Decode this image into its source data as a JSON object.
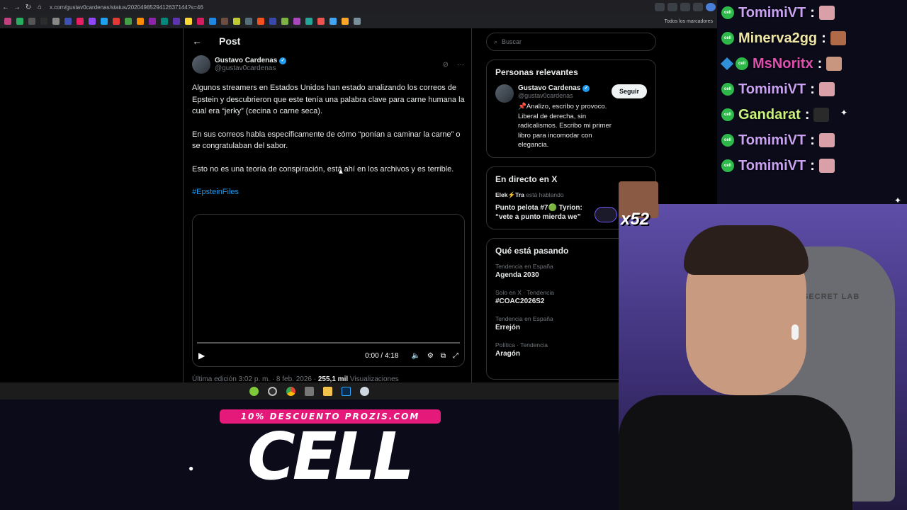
{
  "browser": {
    "url": "x.com/gustav0cardenas/status/2020498529412637144?s=46",
    "bookmarks_folder": "Todos los marcadores"
  },
  "post": {
    "header_title": "Post",
    "author_name": "Gustavo Cardenas",
    "author_handle": "@gustav0cardenas",
    "paragraphs": [
      "Algunos streamers en Estados Unidos han estado analizando los correos de Epstein y descubrieron que este tenía una palabra clave para carne humana la cual era “jerky” (cecina o carne seca).",
      "En sus correos habla específicamente de cómo “ponían a caminar la carne” o se congratulaban del sabor.",
      "Esto no es una teoría de conspiración, está ahí en los archivos y es terrible."
    ],
    "hashtag": "#EpsteinFiles",
    "video_time": "0:00 / 4:18",
    "edit_line_prefix": "Última edición 3:02 p. m. · 8 feb. 2026 · ",
    "views_count": "255,1 mil",
    "views_label": " Visualizaciones"
  },
  "sidebar": {
    "search_placeholder": "Buscar",
    "relevant_title": "Personas relevantes",
    "relevant_name": "Gustavo Cardenas",
    "relevant_handle": "@gustav0cardenas",
    "relevant_bio": "📌Analizo, escribo y provoco. Liberal de derecha, sin radicalismos. Escribo mi primer libro para incomodar con elegancia.",
    "follow_label": "Seguir",
    "live_title": "En directo en X",
    "live_host": "Elek⚡Tra",
    "live_host_suffix": " está hablando",
    "live_stream_title": "Punto pelota #7🟢 Tyrion: “vete a punto mierda we”",
    "trending_title": "Qué está pasando",
    "trends": [
      {
        "meta": "Tendencia en España",
        "name": "Agenda 2030"
      },
      {
        "meta": "Solo en X · Tendencia",
        "name": "#COAC2026S2"
      },
      {
        "meta": "Tendencia en España",
        "name": "Errejón"
      },
      {
        "meta": "Política · Tendencia",
        "name": "Aragón"
      }
    ]
  },
  "promo": {
    "band_text": "10% DESCUENTO PROZIS.COM",
    "logo_text": "CELL"
  },
  "overlay": {
    "count": "x52"
  },
  "webcam": {
    "chair_brand": "SECRET LAB"
  },
  "chat": [
    {
      "name": "TomimiVT",
      "color": "#c9a2f2",
      "badge": "cell",
      "emote_color": "#d9a0a8"
    },
    {
      "name": "Minerva2gg",
      "color": "#efe6a6",
      "badge": "cell",
      "emote_color": "#b06a48"
    },
    {
      "name": "MsNoritx",
      "color": "#e04fb0",
      "badge": "cube",
      "emote_color": "#c8967e"
    },
    {
      "name": "TomimiVT",
      "color": "#c9a2f2",
      "badge": "cell",
      "emote_color": "#d9a0a8"
    },
    {
      "name": "Gandarat",
      "color": "#c9f27a",
      "badge": "cell",
      "emote_color": "#2a2a2a"
    },
    {
      "name": "TomimiVT",
      "color": "#c9a2f2",
      "badge": "cell",
      "emote_color": "#d9a0a8"
    },
    {
      "name": "TomimiVT",
      "color": "#c9a2f2",
      "badge": "cell",
      "emote_color": "#d9a0a8"
    }
  ],
  "colors": {
    "accent": "#1d9bf0",
    "promo_pink": "#e4197a",
    "badge_green": "#2fb84a"
  }
}
